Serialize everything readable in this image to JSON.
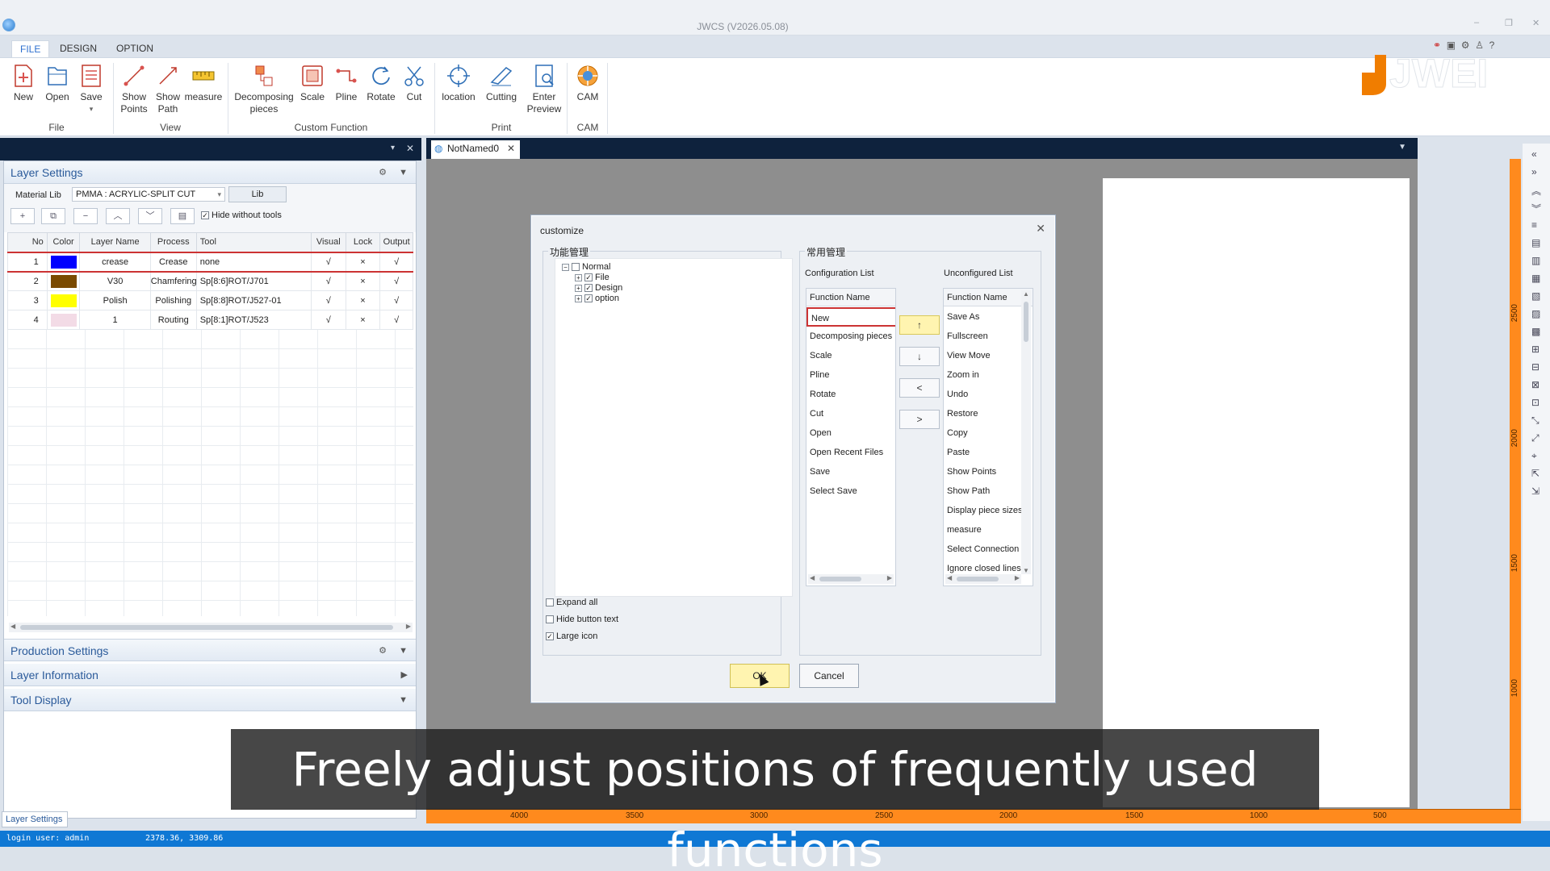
{
  "window": {
    "title": "JWCS (V2026.05.08)"
  },
  "menu_tabs": [
    {
      "label": "FILE"
    },
    {
      "label": "DESIGN"
    },
    {
      "label": "OPTION"
    }
  ],
  "ribbon": {
    "buttons": [
      {
        "label": "New",
        "icon": "new-file-icon"
      },
      {
        "label": "Open",
        "icon": "open-file-icon"
      },
      {
        "label": "Save",
        "icon": "save-icon"
      },
      {
        "label": "Show\nPoints",
        "icon": "show-points-icon"
      },
      {
        "label": "Show\nPath",
        "icon": "show-path-icon"
      },
      {
        "label": "measure",
        "icon": "measure-icon"
      },
      {
        "label": "Decomposing\npieces",
        "icon": "decompose-icon"
      },
      {
        "label": "Scale",
        "icon": "scale-icon"
      },
      {
        "label": "Pline",
        "icon": "pline-icon"
      },
      {
        "label": "Rotate",
        "icon": "rotate-icon"
      },
      {
        "label": "Cut",
        "icon": "scissors-icon"
      },
      {
        "label": "location",
        "icon": "crosshair-icon"
      },
      {
        "label": "Cutting",
        "icon": "cutting-icon"
      },
      {
        "label": "Enter\nPreview",
        "icon": "preview-icon"
      },
      {
        "label": "CAM",
        "icon": "cam-icon"
      }
    ],
    "groups": [
      {
        "label": "File"
      },
      {
        "label": "View"
      },
      {
        "label": "Custom Function"
      },
      {
        "label": "Print"
      },
      {
        "label": "CAM"
      }
    ]
  },
  "brand": {
    "logo_text": "JWEI",
    "accent": "#f07d00"
  },
  "layer_settings": {
    "title": "Layer Settings",
    "material_label": "Material Lib",
    "material_value": "PMMA : ACRYLIC-SPLIT CUT",
    "lib_button": "Lib",
    "hide_without_tools": "Hide without tools",
    "columns": [
      "No",
      "Color",
      "Layer Name",
      "Process",
      "Tool",
      "Visual",
      "Lock",
      "Output"
    ],
    "rows": [
      {
        "no": "1",
        "color": "#0000ff",
        "name": "crease",
        "process": "Crease",
        "tool": "none",
        "visual": "√",
        "lock": "×",
        "output": "√"
      },
      {
        "no": "2",
        "color": "#7a4a00",
        "name": "V30",
        "process": "Chamfering",
        "tool": "Sp[8:6]ROT/J701",
        "visual": "√",
        "lock": "×",
        "output": "√"
      },
      {
        "no": "3",
        "color": "#ffff00",
        "name": "Polish",
        "process": "Polishing",
        "tool": "Sp[8:8]ROT/J527-01",
        "visual": "√",
        "lock": "×",
        "output": "√"
      },
      {
        "no": "4",
        "color": "#f3dbe6",
        "name": "1",
        "process": "Routing",
        "tool": "Sp[8:1]ROT/J523",
        "visual": "√",
        "lock": "×",
        "output": "√"
      }
    ]
  },
  "panels": {
    "production": "Production Settings",
    "layer_info": "Layer Information",
    "tool_display": "Tool Display",
    "bottom_tab": "Layer Settings"
  },
  "document_tab": {
    "label": "NotNamed0"
  },
  "ruler": {
    "labels": [
      "4000",
      "3500",
      "3000",
      "2500",
      "2000",
      "1500",
      "1000",
      "500"
    ],
    "vlabels": [
      "2500",
      "2000",
      "1500",
      "1000"
    ]
  },
  "status": {
    "login": "login user:  admin",
    "coords": "2378.36, 3309.86"
  },
  "dialog": {
    "title": "customize",
    "left_legend": "功能管理",
    "right_legend": "常用管理",
    "tree": [
      {
        "label": "Normal",
        "expander": "−",
        "checked": ""
      },
      {
        "label": "File",
        "expander": "+",
        "checked": "✓"
      },
      {
        "label": "Design",
        "expander": "+",
        "checked": "✓"
      },
      {
        "label": "option",
        "expander": "+",
        "checked": "✓"
      }
    ],
    "options": [
      {
        "label": "Expand all",
        "checked": ""
      },
      {
        "label": "Hide button text",
        "checked": ""
      },
      {
        "label": "Large icon",
        "checked": "✓"
      }
    ],
    "config_list_title": "Configuration List",
    "unconfig_list_title": "Unconfigured List",
    "column_header": "Function Name",
    "configured": [
      "New",
      "Decomposing pieces",
      "Scale",
      "Pline",
      "Rotate",
      "Cut",
      "Open",
      "Open Recent Files",
      "Save",
      "Select Save"
    ],
    "unconfigured": [
      "Save As",
      "Fullscreen",
      "View Move",
      "Zoom in",
      "Undo",
      "Restore",
      "Copy",
      "Paste",
      "Show Points",
      "Show Path",
      "Display piece sizes",
      "measure",
      "Select Connection l",
      "Ignore closed lines"
    ],
    "move_buttons": [
      "↑",
      "↓",
      "<",
      ">"
    ],
    "ok": "OK",
    "cancel": "Cancel"
  },
  "subtitle": "Freely adjust positions of frequently used functions"
}
